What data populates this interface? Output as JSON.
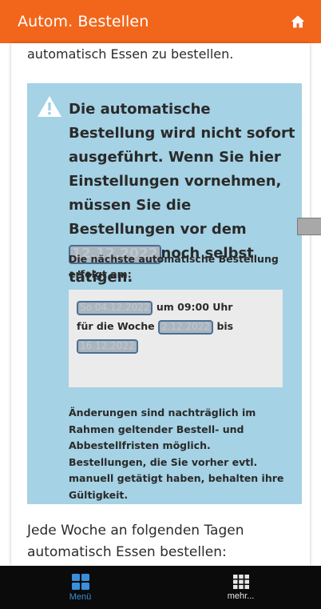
{
  "header": {
    "title": "Autom. Bestellen",
    "home_icon": "home-icon"
  },
  "intro_text": "automatisch Essen zu bestellen.",
  "notice": {
    "heading_main": "Die automatische Bestellung wird nicht sofort ausgeführt. Wenn Sie hier Einstellungen vornehmen, müssen Sie die Bestellungen vor dem",
    "heading_date": "12.12.2022",
    "heading_tail": "noch selbst tätigen.",
    "next_label": "Die nächste automatische Bestellung erfolgt am:",
    "schedule": {
      "date": "So 04.12.2022",
      "time_text": "um 09:00 Uhr",
      "week_prefix": "für die Woche",
      "week_start": "2.12.2022",
      "bis": "bis",
      "week_end": "16.12.2022"
    },
    "changes_text": "Änderungen sind nachträglich im Rahmen geltender Bestell- und Abbestellfristen möglich. Bestellungen, die Sie vorher evtl. manuell getätigt haben, behalten ihre Gültigkeit."
  },
  "weekly_text": "Jede Woche an folgenden Tagen automatisch Essen bestellen:",
  "bottom_nav": {
    "menu_label": "Menü",
    "more_label": "mehr..."
  },
  "colors": {
    "accent": "#f2661b",
    "notice_bg": "#a5d2e4",
    "nav_active": "#3a8fd8"
  }
}
